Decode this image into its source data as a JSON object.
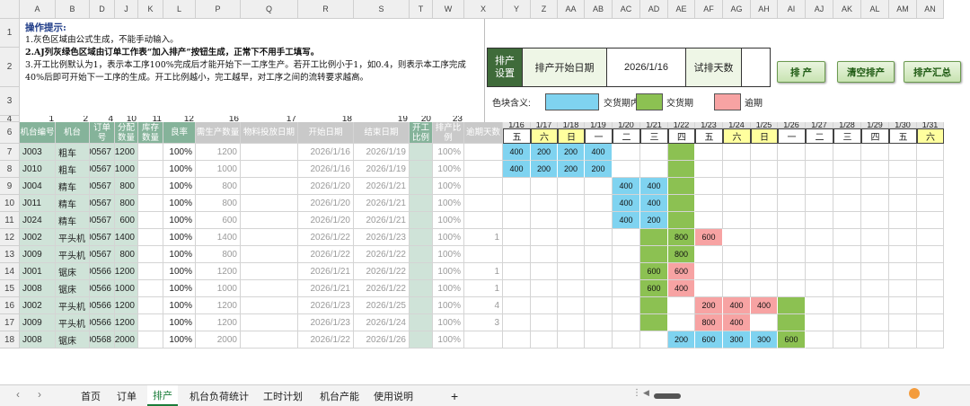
{
  "column_letters": [
    "A",
    "B",
    "D",
    "J",
    "K",
    "L",
    "P",
    "Q",
    "R",
    "S",
    "T",
    "W",
    "X",
    "Y",
    "Z",
    "AA",
    "AB",
    "AC",
    "AD",
    "AE",
    "AF",
    "AG",
    "AH",
    "AI",
    "AJ",
    "AK",
    "AL",
    "AM",
    "AN"
  ],
  "row_numbers": [
    "1",
    "2",
    "3",
    "4",
    "6",
    "7",
    "8",
    "9",
    "10",
    "11",
    "12",
    "13",
    "14",
    "15",
    "16",
    "17",
    "18"
  ],
  "notes": {
    "title": "操作提示:",
    "line1": "1.灰色区域由公式生成，不能手动输入。",
    "line2": "2.AJ列灰绿色区域由订单工作表“加入排产”按钮生成，正常下不用手工填写。",
    "line3": "3.开工比例默认为1，表示本工序100%完成后才能开始下一工序生产。若开工比例小于1，如0.4，则表示本工序完成40%后即可开始下一工序的生成。开工比例越小，完工越早，对工序之间的流转要求越高。"
  },
  "settings": {
    "label": "排产设置",
    "start_label": "排产开始日期",
    "start_value": "2026/1/16",
    "trial_label": "试排天数",
    "trial_value": ""
  },
  "buttons": {
    "schedule": "排 产",
    "clear": "清空排产",
    "summary": "排产汇总"
  },
  "legend": {
    "title": "色块含义:",
    "in_period": "交货期内",
    "due": "交货期",
    "overdue": "逾期",
    "colors": {
      "in_period": "#7fd3f0",
      "due": "#8cc152",
      "overdue": "#f7a3a3"
    }
  },
  "col_index_row": [
    "1",
    "2",
    "4",
    "10",
    "11",
    "12",
    "16",
    "17",
    "18",
    "19",
    "20",
    "23"
  ],
  "headers": [
    "机台编号",
    "机台",
    "订单号",
    "分配数量",
    "库存数量",
    "良率",
    "需生产数量",
    "物料投放日期",
    "开始日期",
    "结束日期",
    "开工比例",
    "排产比例",
    "逾期天数"
  ],
  "dates": [
    "1/16",
    "1/17",
    "1/18",
    "1/19",
    "1/20",
    "1/21",
    "1/22",
    "1/23",
    "1/24",
    "1/25",
    "1/26",
    "1/27",
    "1/28",
    "1/29",
    "1/30",
    "1/31"
  ],
  "weekdays": [
    "五",
    "六",
    "日",
    "一",
    "二",
    "三",
    "四",
    "五",
    "六",
    "日",
    "一",
    "二",
    "三",
    "四",
    "五",
    "六"
  ],
  "rows": [
    {
      "code": "J003",
      "machine": "粗车",
      "order": "100567",
      "alloc": "1200",
      "stock": "",
      "yield": "100%",
      "need": "1200",
      "material": "",
      "start": "2026/1/16",
      "end": "2026/1/19",
      "open": "",
      "ratio": "100%",
      "overdue": ""
    },
    {
      "code": "J010",
      "machine": "粗车",
      "order": "100567",
      "alloc": "1000",
      "stock": "",
      "yield": "100%",
      "need": "1000",
      "material": "",
      "start": "2026/1/16",
      "end": "2026/1/19",
      "open": "",
      "ratio": "100%",
      "overdue": ""
    },
    {
      "code": "J004",
      "machine": "精车",
      "order": "100567",
      "alloc": "800",
      "stock": "",
      "yield": "100%",
      "need": "800",
      "material": "",
      "start": "2026/1/20",
      "end": "2026/1/21",
      "open": "",
      "ratio": "100%",
      "overdue": ""
    },
    {
      "code": "J011",
      "machine": "精车",
      "order": "100567",
      "alloc": "800",
      "stock": "",
      "yield": "100%",
      "need": "800",
      "material": "",
      "start": "2026/1/20",
      "end": "2026/1/21",
      "open": "",
      "ratio": "100%",
      "overdue": ""
    },
    {
      "code": "J024",
      "machine": "精车",
      "order": "100567",
      "alloc": "600",
      "stock": "",
      "yield": "100%",
      "need": "600",
      "material": "",
      "start": "2026/1/20",
      "end": "2026/1/21",
      "open": "",
      "ratio": "100%",
      "overdue": ""
    },
    {
      "code": "J002",
      "machine": "平头机",
      "order": "100567",
      "alloc": "1400",
      "stock": "",
      "yield": "100%",
      "need": "1400",
      "material": "",
      "start": "2026/1/22",
      "end": "2026/1/23",
      "open": "",
      "ratio": "100%",
      "overdue": "1"
    },
    {
      "code": "J009",
      "machine": "平头机",
      "order": "100567",
      "alloc": "800",
      "stock": "",
      "yield": "100%",
      "need": "800",
      "material": "",
      "start": "2026/1/22",
      "end": "2026/1/22",
      "open": "",
      "ratio": "100%",
      "overdue": ""
    },
    {
      "code": "J001",
      "machine": "锯床",
      "order": "100566",
      "alloc": "1200",
      "stock": "",
      "yield": "100%",
      "need": "1200",
      "material": "",
      "start": "2026/1/21",
      "end": "2026/1/22",
      "open": "",
      "ratio": "100%",
      "overdue": "1"
    },
    {
      "code": "J008",
      "machine": "锯床",
      "order": "100566",
      "alloc": "1000",
      "stock": "",
      "yield": "100%",
      "need": "1000",
      "material": "",
      "start": "2026/1/21",
      "end": "2026/1/22",
      "open": "",
      "ratio": "100%",
      "overdue": "1"
    },
    {
      "code": "J002",
      "machine": "平头机",
      "order": "100566",
      "alloc": "1200",
      "stock": "",
      "yield": "100%",
      "need": "1200",
      "material": "",
      "start": "2026/1/23",
      "end": "2026/1/25",
      "open": "",
      "ratio": "100%",
      "overdue": "4"
    },
    {
      "code": "J009",
      "machine": "平头机",
      "order": "100566",
      "alloc": "1200",
      "stock": "",
      "yield": "100%",
      "need": "1200",
      "material": "",
      "start": "2026/1/23",
      "end": "2026/1/24",
      "open": "",
      "ratio": "100%",
      "overdue": "3"
    },
    {
      "code": "J008",
      "machine": "锯床",
      "order": "100568",
      "alloc": "2000",
      "stock": "",
      "yield": "100%",
      "need": "2000",
      "material": "",
      "start": "2026/1/22",
      "end": "2026/1/26",
      "open": "",
      "ratio": "100%",
      "overdue": ""
    }
  ],
  "gantt": [
    [
      {
        "d": 0,
        "c": "b",
        "v": "400"
      },
      {
        "d": 1,
        "c": "b",
        "v": "200"
      },
      {
        "d": 2,
        "c": "b",
        "v": "200"
      },
      {
        "d": 3,
        "c": "b",
        "v": "400"
      },
      {
        "d": 6,
        "c": "g",
        "v": ""
      }
    ],
    [
      {
        "d": 0,
        "c": "b",
        "v": "400"
      },
      {
        "d": 1,
        "c": "b",
        "v": "200"
      },
      {
        "d": 2,
        "c": "b",
        "v": "200"
      },
      {
        "d": 3,
        "c": "b",
        "v": "200"
      },
      {
        "d": 6,
        "c": "g",
        "v": ""
      }
    ],
    [
      {
        "d": 4,
        "c": "b",
        "v": "400"
      },
      {
        "d": 5,
        "c": "b",
        "v": "400"
      },
      {
        "d": 6,
        "c": "g",
        "v": ""
      }
    ],
    [
      {
        "d": 4,
        "c": "b",
        "v": "400"
      },
      {
        "d": 5,
        "c": "b",
        "v": "400"
      },
      {
        "d": 6,
        "c": "g",
        "v": ""
      }
    ],
    [
      {
        "d": 4,
        "c": "b",
        "v": "400"
      },
      {
        "d": 5,
        "c": "b",
        "v": "200"
      },
      {
        "d": 6,
        "c": "g",
        "v": ""
      }
    ],
    [
      {
        "d": 5,
        "c": "g",
        "v": ""
      },
      {
        "d": 6,
        "c": "g",
        "v": "800"
      },
      {
        "d": 7,
        "c": "r",
        "v": "600"
      }
    ],
    [
      {
        "d": 5,
        "c": "g",
        "v": ""
      },
      {
        "d": 6,
        "c": "g",
        "v": "800"
      }
    ],
    [
      {
        "d": 5,
        "c": "g",
        "v": "600"
      },
      {
        "d": 6,
        "c": "r",
        "v": "600"
      }
    ],
    [
      {
        "d": 5,
        "c": "g",
        "v": "600"
      },
      {
        "d": 6,
        "c": "r",
        "v": "400"
      }
    ],
    [
      {
        "d": 5,
        "c": "g",
        "v": ""
      },
      {
        "d": 7,
        "c": "r",
        "v": "200"
      },
      {
        "d": 8,
        "c": "r",
        "v": "400"
      },
      {
        "d": 9,
        "c": "r",
        "v": "400"
      },
      {
        "d": 10,
        "c": "g",
        "v": ""
      }
    ],
    [
      {
        "d": 5,
        "c": "g",
        "v": ""
      },
      {
        "d": 7,
        "c": "r",
        "v": "800"
      },
      {
        "d": 8,
        "c": "r",
        "v": "400"
      },
      {
        "d": 10,
        "c": "g",
        "v": ""
      }
    ],
    [
      {
        "d": 6,
        "c": "b",
        "v": "200"
      },
      {
        "d": 7,
        "c": "b",
        "v": "600"
      },
      {
        "d": 8,
        "c": "b",
        "v": "300"
      },
      {
        "d": 9,
        "c": "b",
        "v": "300"
      },
      {
        "d": 10,
        "c": "g",
        "v": "600"
      }
    ]
  ],
  "tabs": [
    "首页",
    "订单",
    "排产",
    "机台负荷统计",
    "工时计划",
    "机台产能",
    "使用说明"
  ],
  "active_tab": "排产",
  "add_tab": "+"
}
